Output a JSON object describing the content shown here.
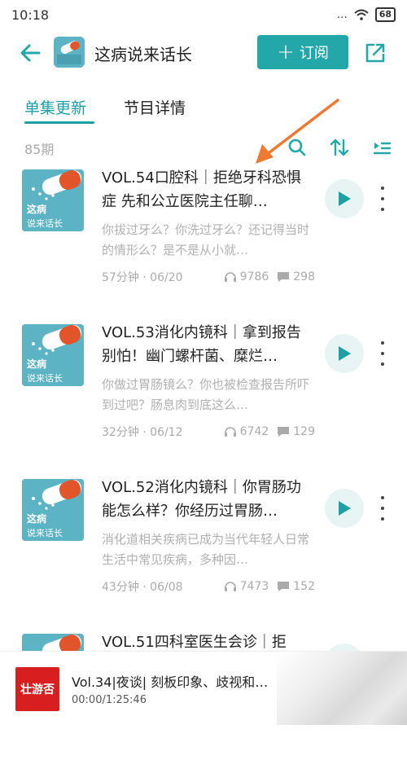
{
  "status_bar": {
    "time": "10:18",
    "battery": "68"
  },
  "header": {
    "program_title": "这病说来话长",
    "subscribe_plus": "+",
    "subscribe_label": "订阅"
  },
  "tabs": [
    {
      "label": "单集更新",
      "active": true
    },
    {
      "label": "节目详情",
      "active": false
    }
  ],
  "episode_count": "85期",
  "thumbnail_text": {
    "line1": "这病",
    "line2": "说来话长"
  },
  "episodes": [
    {
      "title": "VOL.54口腔科｜拒绝牙科恐惧症 先和公立医院主任聊…",
      "description": "你拔过牙么？你洗过牙么？还记得当时的情形么？是不是从小就…",
      "duration_date": "57分钟 · 06/20",
      "plays": "9786",
      "comments": "298"
    },
    {
      "title": "VOL.53消化内镜科｜拿到报告别怕！幽门螺杆菌、糜烂…",
      "description": "你做过胃肠镜么？你也被检查报告所吓到过吧？肠息肉到底这么…",
      "duration_date": "32分钟 · 06/12",
      "plays": "6742",
      "comments": "129"
    },
    {
      "title": "VOL.52消化内镜科｜你胃肠功能怎么样？你经历过胃肠…",
      "description": "消化道相关疾病已成为当代年轻人日常生活中常见疾病，多种因…",
      "duration_date": "43分钟 · 06/08",
      "plays": "7473",
      "comments": "152"
    },
    {
      "title": "VOL.51四科室医生会诊｜拒",
      "description": "",
      "duration_date": "",
      "plays": "",
      "comments": ""
    }
  ],
  "player": {
    "cover_text": "壮游否",
    "title": "Vol.34|夜谈| 刻板印象、歧视和…",
    "time": "00:00/1:25:46"
  },
  "colors": {
    "accent": "#24a7a8",
    "annotation_arrow": "#ee7a32",
    "cover_red": "#d81e1e"
  }
}
